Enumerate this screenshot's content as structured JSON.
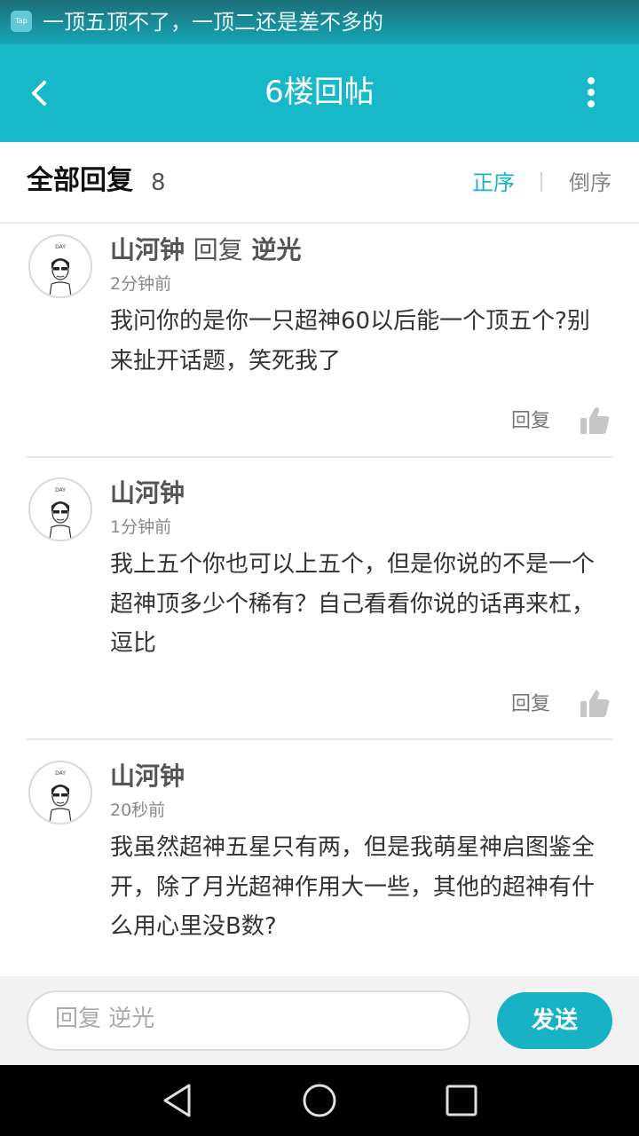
{
  "status_bar": {
    "app_icon_text": "Tap",
    "notification": "一顶五顶不了，一顶二还是差不多的"
  },
  "header": {
    "title": "6楼回帖",
    "back_icon": "chevron-left-icon",
    "more_icon": "more-vertical-icon"
  },
  "replies_bar": {
    "title": "全部回复",
    "count": "8",
    "sort_asc": "正序",
    "sort_desc": "倒序",
    "active_color": "#17b2c4"
  },
  "comments": [
    {
      "author": "山河钟",
      "reply_word": "回复",
      "reply_to": "逆光",
      "time": "2分钟前",
      "content": "我问你的是你一只超神60以后能一个顶五个?别来扯开话题，笑死我了",
      "reply_label": "回复"
    },
    {
      "author": "山河钟",
      "time": "1分钟前",
      "content": "我上五个你也可以上五个，但是你说的不是一个超神顶多少个稀有？自己看看你说的话再来杠，逗比",
      "reply_label": "回复"
    },
    {
      "author": "山河钟",
      "time": "20秒前",
      "content": "我虽然超神五星只有两，但是我萌星神启图鉴全开，除了月光超神作用大一些，其他的超神有什么用心里没B数?"
    }
  ],
  "input_bar": {
    "placeholder": "回复 逆光",
    "send_label": "发送"
  },
  "nav_bar": {
    "back_icon": "triangle-back-icon",
    "home_icon": "circle-home-icon",
    "recents_icon": "square-recents-icon"
  },
  "colors": {
    "header_bg": "#17b9c9",
    "accent": "#17b2c4"
  }
}
